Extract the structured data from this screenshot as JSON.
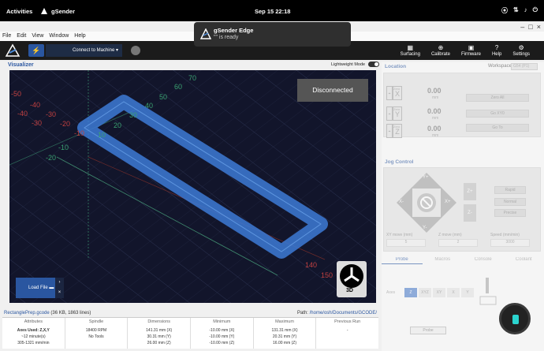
{
  "system": {
    "activities": "Activities",
    "app_name": "gSender",
    "clock": "Sep 15  22:18"
  },
  "menu": [
    "File",
    "Edit",
    "View",
    "Window",
    "Help"
  ],
  "toolbar": {
    "connect_label": "Connect to Machine ▾",
    "items": [
      {
        "label": "Surfacing",
        "icon": "surfacing-icon"
      },
      {
        "label": "Calibrate",
        "icon": "calibrate-icon"
      },
      {
        "label": "Firmware",
        "icon": "firmware-icon"
      },
      {
        "label": "Help",
        "icon": "help-icon"
      },
      {
        "label": "Settings",
        "icon": "settings-icon"
      }
    ]
  },
  "notification": {
    "title": "gSender Edge",
    "subtitle": "\"\" is ready"
  },
  "visualizer": {
    "title": "Visualizer",
    "lightweight_label": "Lightweight Mode",
    "status": "Disconnected",
    "load_file": "Load File",
    "view_mode": "3D",
    "axis_numbers": {
      "y": [
        "70",
        "60",
        "50",
        "40",
        "30",
        "20",
        "10"
      ],
      "x_neg": [
        "-40",
        "-30",
        "-20",
        "-10"
      ],
      "x_pos": [
        "140",
        "150"
      ],
      "misc": [
        "-50",
        "-40",
        "-30",
        "-10",
        "-20"
      ]
    }
  },
  "fileinfo": {
    "filename": "RectanglePrep.gcode",
    "meta": "(36 KB, 1863 lines)",
    "path_label": "Path:",
    "path": "/home/osh/Documents/GCODE/"
  },
  "table": [
    {
      "header": "Attributes",
      "lines": [
        "Axes Used: Z,X,Y",
        "~12 minute(s)",
        "305-1321 mm/min"
      ]
    },
    {
      "header": "Spindle",
      "lines": [
        "",
        "18400 RPM",
        "No Tools"
      ]
    },
    {
      "header": "Dimensions",
      "lines": [
        "141.31 mm (X)",
        "30.31 mm (Y)",
        "26.00 mm (Z)"
      ]
    },
    {
      "header": "Minimum",
      "lines": [
        "-10.00 mm (X)",
        "-10.00 mm (Y)",
        "-10.00 mm (Z)"
      ]
    },
    {
      "header": "Maximum",
      "lines": [
        "131.31 mm (X)",
        "20.31 mm (Y)",
        "16.00 mm (Z)"
      ]
    },
    {
      "header": "Previous Run",
      "lines": [
        "",
        "",
        "-"
      ]
    }
  ],
  "location": {
    "title": "Location",
    "workspace_label": "Workspace:",
    "workspace_value": "G54 (P1)",
    "axes": [
      {
        "name": "X",
        "value": "0.00",
        "unit": "mm",
        "zero_label": "Zero"
      },
      {
        "name": "Y",
        "value": "0.00",
        "unit": "mm",
        "zero_label": "Zero"
      },
      {
        "name": "Z",
        "value": "0.00",
        "unit": "mm",
        "zero_label": "Zero"
      }
    ],
    "buttons": [
      "Zero All",
      "Go XY0",
      "Go To"
    ]
  },
  "jog": {
    "title": "Jog Control",
    "speed_buttons": [
      "Rapid",
      "Normal",
      "Precise"
    ],
    "xy_label": "XY move (mm)",
    "xy_value": "5",
    "z_label": "Z move (mm)",
    "z_value": "2",
    "speed_label": "Speed (mm/min)",
    "speed_value": "3000",
    "dirs": {
      "yp": "Y+",
      "yn": "Y-",
      "xn": "X-",
      "xp": "X+",
      "zp": "Z+",
      "zn": "Z-"
    }
  },
  "tabs": [
    "Probe",
    "Macros",
    "Console",
    "Coolant"
  ],
  "probe": {
    "axes_label": "Axes",
    "axes": [
      "Z",
      "XYZ",
      "XY",
      "X",
      "Y"
    ],
    "button": "Probe"
  }
}
